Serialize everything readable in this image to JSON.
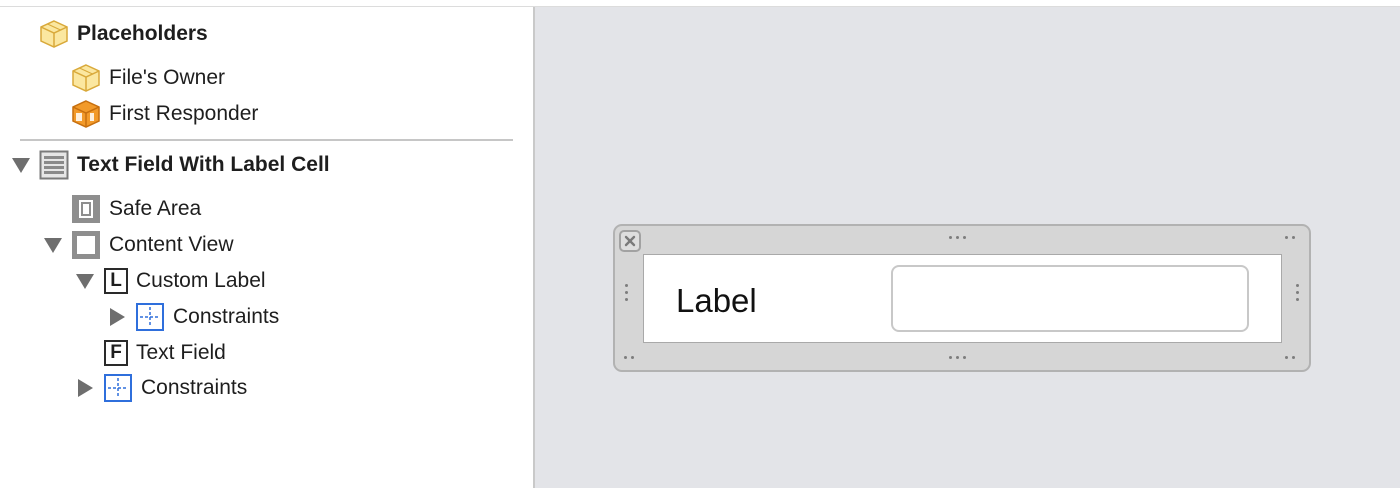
{
  "outline": {
    "placeholders": {
      "header": "Placeholders",
      "items": [
        {
          "label": "File's Owner",
          "icon": "placeholder-cube-icon"
        },
        {
          "label": "First Responder",
          "icon": "first-responder-icon"
        }
      ]
    },
    "tree": {
      "root": {
        "label": "Text Field With Label Cell",
        "icon": "table-cell-icon",
        "expanded": true
      },
      "safe_area": {
        "label": "Safe Area",
        "icon": "safe-area-icon"
      },
      "content_view": {
        "label": "Content View",
        "icon": "view-icon",
        "expanded": true
      },
      "custom_label": {
        "label": "Custom Label",
        "icon_letter": "L",
        "expanded": true
      },
      "custom_label_constraints": {
        "label": "Constraints",
        "icon": "constraints-icon",
        "expanded": false
      },
      "text_field": {
        "label": "Text Field",
        "icon_letter": "F"
      },
      "constraints": {
        "label": "Constraints",
        "icon": "constraints-icon",
        "expanded": false
      }
    }
  },
  "canvas": {
    "cell": {
      "label_text": "Label",
      "text_field_value": ""
    }
  },
  "colors": {
    "placeholder_cube": "#f6d878",
    "first_responder": "#f29a2a",
    "constraints_blue": "#2f6fdc",
    "canvas_bg": "#e3e4e8"
  }
}
